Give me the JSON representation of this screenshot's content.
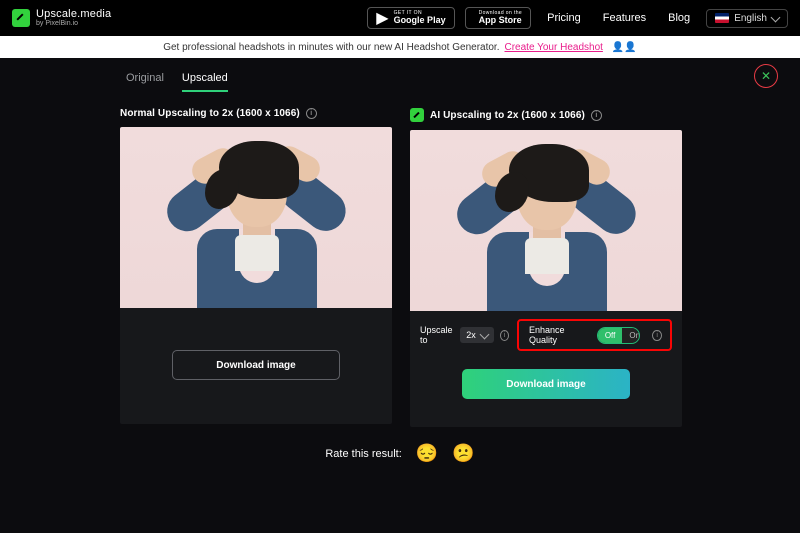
{
  "header": {
    "brand_title": "Upscale.media",
    "brand_sub": "by PixelBin.io",
    "store_google_tiny": "GET IT ON",
    "store_google_big": "Google Play",
    "store_apple_tiny": "Download on the",
    "store_apple_big": "App Store",
    "nav": {
      "pricing": "Pricing",
      "features": "Features",
      "blog": "Blog"
    },
    "lang_label": "English"
  },
  "promo": {
    "text": "Get professional headshots in minutes with our new AI Headshot Generator.",
    "link": "Create Your Headshot",
    "icons": "👤👤"
  },
  "tabs": {
    "original": "Original",
    "upscaled": "Upscaled"
  },
  "panels": {
    "normal": {
      "title": "Normal Upscaling to 2x (1600 x 1066)",
      "download": "Download image"
    },
    "ai": {
      "title": "AI Upscaling to 2x (1600 x 1066)",
      "upscale_label": "Upscale to",
      "upscale_value": "2x",
      "enhance_label": "Enhance Quality",
      "toggle_off": "Off",
      "toggle_on": "On",
      "download": "Download image"
    }
  },
  "rate": {
    "label": "Rate this result:"
  },
  "close_glyph": "✕",
  "info_glyph": "i"
}
